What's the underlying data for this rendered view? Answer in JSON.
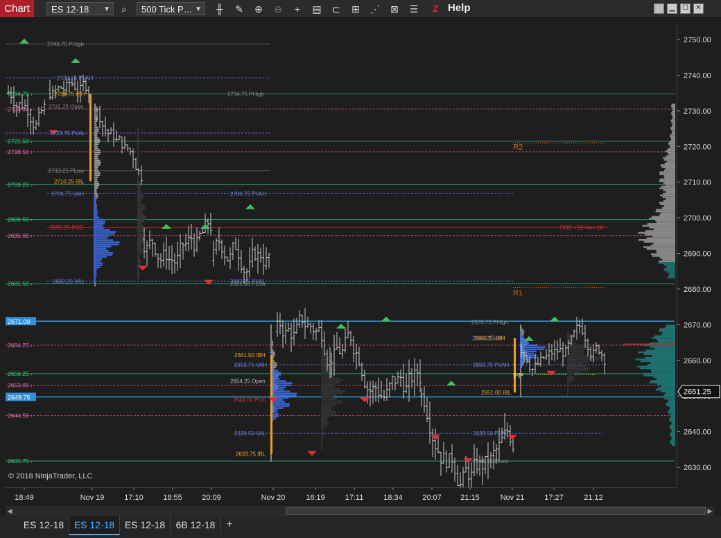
{
  "toolbar": {
    "title": "Chart",
    "instrument": "ES 12-18",
    "period": "500 Tick P…",
    "help_label": "Help",
    "icons": [
      "search-icon",
      "bar-type-icon",
      "draw-pencil-icon",
      "zoom-in-icon",
      "zoom-out-icon",
      "crosshair-icon",
      "data-box-icon",
      "properties-icon",
      "indicators-icon",
      "strategies-icon",
      "template-icon",
      "list-icon"
    ]
  },
  "window_buttons": [
    "window-gray-icon",
    "minimize-icon",
    "maximize-icon",
    "close-icon"
  ],
  "chart_data": {
    "type": "bar",
    "y_axis_ticks": [
      "2750.00",
      "2740.00",
      "2730.00",
      "2720.00",
      "2710.00",
      "2700.00",
      "2690.00",
      "2680.00",
      "2670.00",
      "2660.00",
      "2650.00",
      "2640.00",
      "2630.00"
    ],
    "y_range": [
      2627,
      2753
    ],
    "x_axis_ticks": [
      "18:49",
      "Nov 19",
      "17:10",
      "18:55",
      "20:09",
      "Nov 20",
      "16:19",
      "17:11",
      "18:34",
      "20:07",
      "21:15",
      "Nov 21",
      "17:27",
      "21:12"
    ],
    "last_price": "2651.25",
    "left_markers": [
      {
        "label": "2734.75",
        "price": 2734.75,
        "color": "#2fd07a"
      },
      {
        "label": "2730.50",
        "price": 2730.5,
        "color": "#e86aa8"
      },
      {
        "label": "2721.50",
        "price": 2721.5,
        "color": "#2fd07a"
      },
      {
        "label": "2718.50",
        "price": 2718.5,
        "color": "#e86aa8"
      },
      {
        "label": "2709.25",
        "price": 2709.25,
        "color": "#2fd07a"
      },
      {
        "label": "2699.50",
        "price": 2699.5,
        "color": "#2fd07a"
      },
      {
        "label": "2695.00",
        "price": 2695.0,
        "color": "#e86aa8"
      },
      {
        "label": "2681.50",
        "price": 2681.5,
        "color": "#2fd07a"
      },
      {
        "label": "2664.25",
        "price": 2664.25,
        "color": "#e86aa8"
      },
      {
        "label": "2656.25",
        "price": 2656.25,
        "color": "#2fd07a"
      },
      {
        "label": "2653.00",
        "price": 2653.0,
        "color": "#e86aa8"
      },
      {
        "label": "2644.50",
        "price": 2644.5,
        "color": "#e86aa8"
      },
      {
        "label": "2631.75",
        "price": 2631.75,
        "color": "#2fd07a"
      }
    ],
    "boxed_markers": [
      {
        "label": "2671.00",
        "price": 2671.0
      },
      {
        "label": "2649.75",
        "price": 2649.75
      }
    ],
    "level_labels": [
      {
        "text": "2748.75 PHigh",
        "price": 2748.75,
        "color": "#888"
      },
      {
        "text": "2739.25 PVAH",
        "price": 2739.25,
        "color": "#6b7fd6"
      },
      {
        "text": "2734.75 IBH",
        "price": 2734.75,
        "color": "#f0a020"
      },
      {
        "text": "2734.75 PHigh",
        "price": 2734.75,
        "color": "#888"
      },
      {
        "text": "2731.25 Open",
        "price": 2731.25,
        "color": "#888"
      },
      {
        "text": "2723.75 PVAL",
        "price": 2723.75,
        "color": "#6b7fd6"
      },
      {
        "text": "2713.25 PLow",
        "price": 2713.25,
        "color": "#888"
      },
      {
        "text": "2710.25 IBL",
        "price": 2710.25,
        "color": "#f0a020"
      },
      {
        "text": "2706.75 VAH",
        "price": 2706.75,
        "color": "#6b7fd6"
      },
      {
        "text": "2706.75 PVAH",
        "price": 2706.75,
        "color": "#6b7fd6"
      },
      {
        "text": "2697.25 POC",
        "price": 2697.25,
        "color": "#d83030"
      },
      {
        "text": "POC • 19-Nov-18",
        "price": 2697.25,
        "color": "#d83030"
      },
      {
        "text": "2682.25 VAL",
        "price": 2682.25,
        "color": "#6b7fd6"
      },
      {
        "text": "2682.25 PVAL",
        "price": 2682.25,
        "color": "#6b7fd6"
      },
      {
        "text": "2681.50 PLow",
        "price": 2681.5,
        "color": "#888"
      },
      {
        "text": "2670.75 PHigh",
        "price": 2670.75,
        "color": "#888"
      },
      {
        "text": "2666.25 VAH",
        "price": 2666.25,
        "color": "#6b7fd6"
      },
      {
        "text": "2666.25 IBH",
        "price": 2666.25,
        "color": "#f0a020"
      },
      {
        "text": "2661.50 IBH",
        "price": 2661.5,
        "color": "#f0a020"
      },
      {
        "text": "2658.75 VAH",
        "price": 2658.75,
        "color": "#6b7fd6"
      },
      {
        "text": "2658.75 PVAH",
        "price": 2658.75,
        "color": "#6b7fd6"
      },
      {
        "text": "2654.25 Open",
        "price": 2654.25,
        "color": "#bbb"
      },
      {
        "text": "2649.00 POC",
        "price": 2649.0,
        "color": "#d83030"
      },
      {
        "text": "2651.00 IBL",
        "price": 2651.0,
        "color": "#f0a020"
      },
      {
        "text": "2639.50 VAL",
        "price": 2639.5,
        "color": "#6b7fd6"
      },
      {
        "text": "2639.50 PVAL",
        "price": 2639.5,
        "color": "#6b7fd6"
      },
      {
        "text": "2633.75 IBL",
        "price": 2633.75,
        "color": "#f0a020"
      },
      {
        "text": "2631.75 PLow",
        "price": 2631.75,
        "color": "#888"
      }
    ],
    "pivot_labels": [
      {
        "text": "R2",
        "price": 2720.0
      },
      {
        "text": "R1",
        "price": 2679.0
      },
      {
        "text": "PP",
        "price": 2655.0
      }
    ]
  },
  "copyright": "© 2018 NinjaTrader, LLC",
  "tabs": [
    {
      "label": "ES 12-18",
      "active": false
    },
    {
      "label": "ES 12-18",
      "active": true
    },
    {
      "label": "ES 12-18",
      "active": false
    },
    {
      "label": "6B 12-18",
      "active": false
    }
  ],
  "add_tab_label": "+"
}
